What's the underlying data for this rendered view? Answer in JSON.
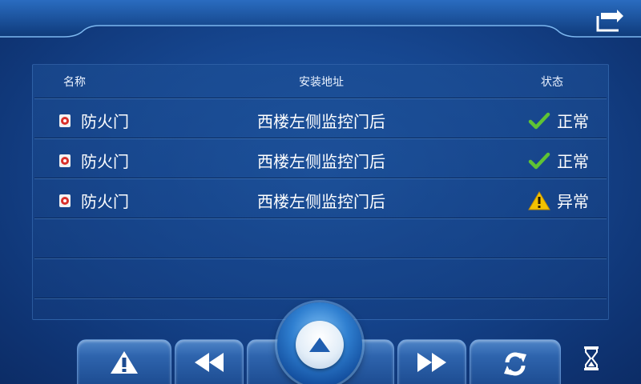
{
  "table": {
    "headers": {
      "name": "名称",
      "address": "安装地址",
      "status": "状态"
    },
    "rows": [
      {
        "name": "防火门",
        "address": "西楼左侧监控门后",
        "status": "正常",
        "status_icon": "check-icon"
      },
      {
        "name": "防火门",
        "address": "西楼左侧监控门后",
        "status": "正常",
        "status_icon": "check-icon"
      },
      {
        "name": "防火门",
        "address": "西楼左侧监控门后",
        "status": "异常",
        "status_icon": "warning-icon"
      }
    ]
  },
  "icons": {
    "device": "fire-door-icon",
    "back": "back-arrow-icon",
    "toolbar": [
      "alert-icon",
      "rewind-icon",
      "eject-up-icon",
      "fast-forward-icon",
      "refresh-icon",
      "hourglass-icon"
    ]
  },
  "colors": {
    "background": "#16468f",
    "ok": "#5fc334",
    "warning": "#f2c200",
    "device_red": "#d9302a"
  }
}
